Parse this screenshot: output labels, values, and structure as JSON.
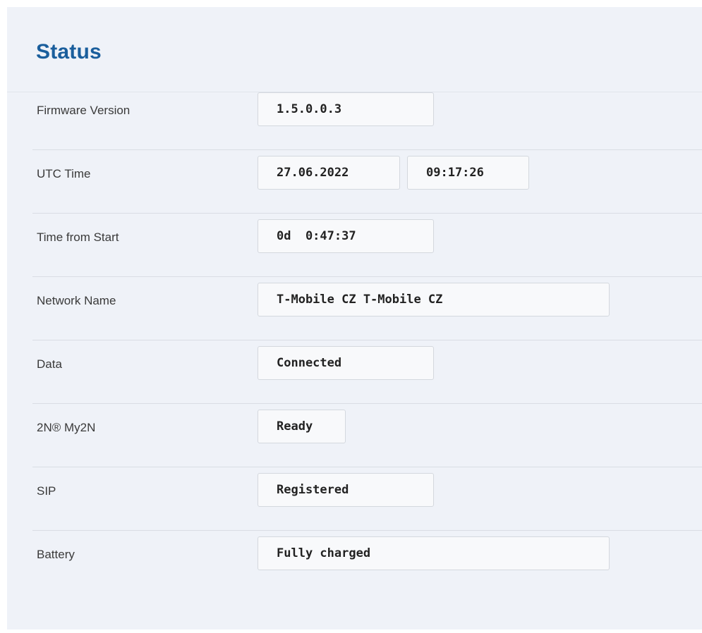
{
  "header": {
    "title": "Status"
  },
  "rows": {
    "firmware": {
      "label": "Firmware Version",
      "value": "1.5.0.0.3"
    },
    "utc_time": {
      "label": "UTC Time",
      "date": "27.06.2022",
      "time": "09:17:26"
    },
    "uptime": {
      "label": "Time from Start",
      "value": "0d  0:47:37"
    },
    "network": {
      "label": "Network Name",
      "value": "T-Mobile CZ T-Mobile CZ"
    },
    "data": {
      "label": "Data",
      "value": "Connected"
    },
    "my2n": {
      "label": "2N® My2N",
      "value": "Ready"
    },
    "sip": {
      "label": "SIP",
      "value": "Registered"
    },
    "battery": {
      "label": "Battery",
      "value": "Fully charged"
    }
  },
  "colors": {
    "title": "#1a5e9c",
    "panel_background": "#eff2f8",
    "field_background": "#f8f9fb",
    "field_border": "#d4d8de"
  }
}
